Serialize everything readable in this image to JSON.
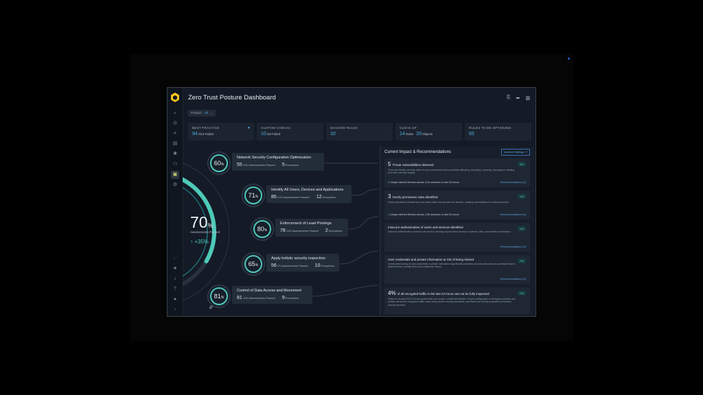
{
  "app": {
    "title": "Zero Trust Posture Dashboard",
    "filter": {
      "label": "Product:",
      "value": "All"
    }
  },
  "cards": [
    {
      "label": "BEST PRACTICE",
      "value": "94",
      "total": "/313",
      "suffix": "Failed"
    },
    {
      "label": "CUSTOM CHECKS",
      "value": "10",
      "total": "/40",
      "suffix": "Failed"
    },
    {
      "label": "SHADOW RULES",
      "value": "10",
      "total": "",
      "suffix": ""
    },
    {
      "label": "CLEAN UP",
      "value": "14",
      "total": "",
      "suffix": "Rules",
      "value2": "20",
      "suffix2": "Objects"
    },
    {
      "label": "RULES TO BE OPTIMIZED",
      "value": "65",
      "total": "",
      "suffix": ""
    }
  ],
  "overall": {
    "percent": "70",
    "percent_sign": "%",
    "label": "Assessments Passed",
    "delta": "+35%",
    "industry": "85% Industry Avg.",
    "progress_fraction": 0.7
  },
  "categories": [
    {
      "percent": "60",
      "name": "Network Security Configuration Optimization",
      "passed": "55",
      "total": "/100",
      "passed_label": "Assessments Passed",
      "exceptions": "5",
      "exceptions_label": "Exceptions"
    },
    {
      "percent": "71",
      "name": "Identify All Users, Devices and Applications",
      "passed": "85",
      "total": "/120",
      "passed_label": "Assessments Passed",
      "exceptions": "12",
      "exceptions_label": "Exceptions"
    },
    {
      "percent": "80",
      "name": "Enforcement of Least Privilege",
      "passed": "78",
      "total": "/100",
      "passed_label": "Assessments Passed",
      "exceptions": "2",
      "exceptions_label": "Exceptions"
    },
    {
      "percent": "65",
      "name": "Apply holistic security inspection",
      "passed": "56",
      "total": "/70",
      "passed_label": "Assessments Passed",
      "exceptions": "10",
      "exceptions_label": "Exceptions"
    },
    {
      "percent": "81",
      "name": "Control of Data Access and Movement",
      "passed": "81",
      "total": "/100",
      "passed_label": "Assessments Passed",
      "exceptions": "9",
      "exceptions_label": "Exceptions"
    }
  ],
  "panel": {
    "title": "Current Impact & Recommendations",
    "button": "Incident Settings",
    "items": [
      {
        "count": "5",
        "title": "Threat vulnerabilities detected",
        "badge": "5%",
        "desc": "There are threats currently active in your environment and potentially infiltrating, disrupting, exposing, damaging or stealing from their intended targets.",
        "metric_num": "5",
        "metric": "Unique alerted threats across 3.2k sessions in last 24 hours",
        "link": "Recommendations (3)"
      },
      {
        "count": "3",
        "title": "Overly permissive rules identified",
        "badge": "1%",
        "desc": "Overly permissive firewall rules may allow traffic that shouldn't be allowed, creating vulnerabilities for malicious actors.",
        "metric_num": "1",
        "metric": "Unique alerted threats across 1.5k sessions in last 24 hours",
        "link": "Recommendations (3)"
      },
      {
        "count": "",
        "title": "Insecure authentication of users and services identified",
        "badge": "2%",
        "desc": "Insecure authentication methods can result in allowing unauthorized access to systems, data, and sensitive information.",
        "metric_num": "",
        "metric": "",
        "link": "Recommendations (3)"
      },
      {
        "count": "",
        "title": "User credentials and private information at risk of being shared",
        "badge": "2%",
        "desc": "Unintended sharing of user credentials or private information significantly increases security risks and can potentially lead to data breaches, identity theft, and compliance issues.",
        "metric_num": "",
        "metric": "",
        "link": "Recommendations (3)"
      },
      {
        "count": "4%",
        "title": "of all encrypted traffic in the last 24 hours can not be fully inspected",
        "badge": "2%",
        "desc": "Failure to decrypt SSL/TLS encrypted traffic can result in undetected threats. Proper configuration of decryption policies and profiles will ensure encrypted traffic meets best practice security standards, and that it can be fully inspected by enabled security services.",
        "metric_num": "",
        "metric": "",
        "link": ""
      }
    ]
  },
  "icons": {
    "logo": "hexagon-logo-icon",
    "sidebar": [
      "search-icon",
      "user-circle-icon",
      "route-icon",
      "report-icon",
      "shield-icon",
      "network-icon",
      "dashboard-icon",
      "settings-icon",
      "share-node-icon",
      "star-icon",
      "bell-icon",
      "help-icon",
      "profile-icon",
      "expand-icon"
    ],
    "toolbar": [
      "export-icon",
      "share-icon",
      "document-icon"
    ]
  },
  "colors": {
    "accent": "#4ec9b8",
    "link": "#4fb0e2",
    "background": "#141b26"
  }
}
